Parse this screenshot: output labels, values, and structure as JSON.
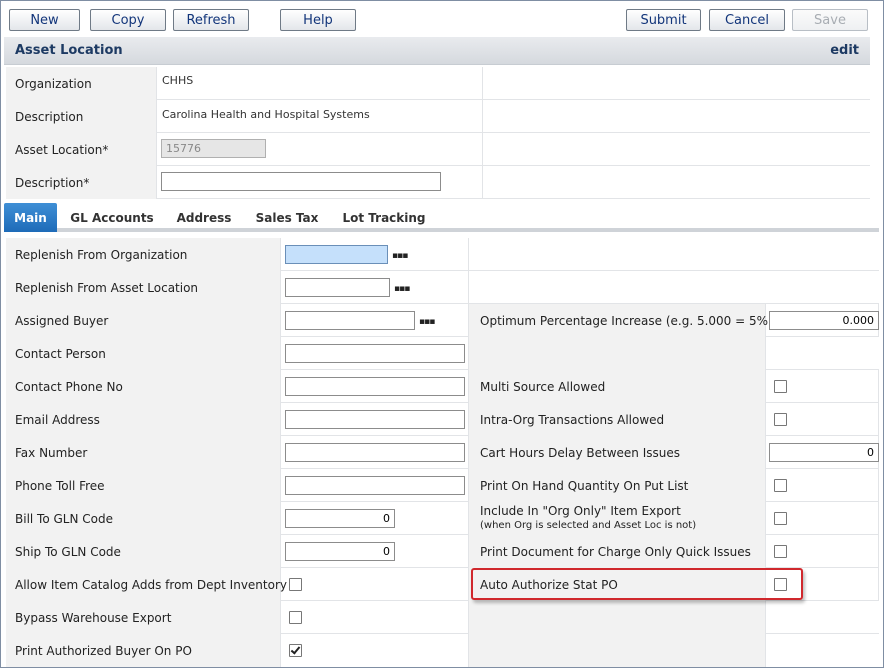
{
  "toolbar": {
    "new_label": "New",
    "copy_label": "Copy",
    "refresh_label": "Refresh",
    "help_label": "Help",
    "submit_label": "Submit",
    "cancel_label": "Cancel",
    "save_label": "Save"
  },
  "header": {
    "title": "Asset Location",
    "mode": "edit"
  },
  "top_form": {
    "organization_label": "Organization",
    "organization_value": "CHHS",
    "description_label": "Description",
    "description_value": "Carolina Health and Hospital Systems",
    "asset_location_label": "Asset Location*",
    "asset_location_value": "15776",
    "description_req_label": "Description*",
    "description_req_value": ""
  },
  "tabs": [
    {
      "label": "Main",
      "active": true
    },
    {
      "label": "GL Accounts"
    },
    {
      "label": "Address"
    },
    {
      "label": "Sales Tax"
    },
    {
      "label": "Lot Tracking"
    }
  ],
  "left_fields": {
    "replenish_org": "Replenish From Organization",
    "replenish_asset": "Replenish From Asset Location",
    "assigned_buyer": "Assigned Buyer",
    "contact_person": "Contact Person",
    "contact_phone": "Contact Phone No",
    "email": "Email Address",
    "fax": "Fax Number",
    "toll_free": "Phone Toll Free",
    "bill_gln": "Bill To GLN Code",
    "bill_gln_value": "0",
    "ship_gln": "Ship To GLN Code",
    "ship_gln_value": "0",
    "allow_catalog": "Allow Item Catalog Adds from Dept Inventory",
    "bypass_wh": "Bypass Warehouse Export",
    "print_buyer": "Print Authorized Buyer On PO"
  },
  "right_fields": {
    "optimum_pct": "Optimum Percentage Increase (e.g. 5.000 = 5%)",
    "optimum_pct_value": "0.000",
    "multi_source": "Multi Source Allowed",
    "intra_org": "Intra-Org Transactions Allowed",
    "cart_hours": "Cart Hours Delay Between Issues",
    "cart_hours_value": "0",
    "print_on_hand": "Print On Hand Quantity On Put List",
    "org_only_line1": "Include In \"Org Only\" Item Export",
    "org_only_line2": "(when Org is selected and Asset Loc is not)",
    "print_doc": "Print Document for Charge Only Quick Issues",
    "auto_authorize": "Auto Authorize Stat PO"
  },
  "checkboxes": {
    "allow_catalog": false,
    "bypass_wh": false,
    "print_buyer": true,
    "multi_source": false,
    "intra_org": false,
    "print_on_hand": false,
    "org_only": false,
    "print_doc": false,
    "auto_authorize": false
  },
  "icons": {
    "lookup": "lookup-dots-icon",
    "checkmark": "checkmark-icon"
  },
  "colors": {
    "tab_active": "#1e6bb8",
    "header_text": "#1d3a63",
    "highlight_border": "#d0282d"
  }
}
